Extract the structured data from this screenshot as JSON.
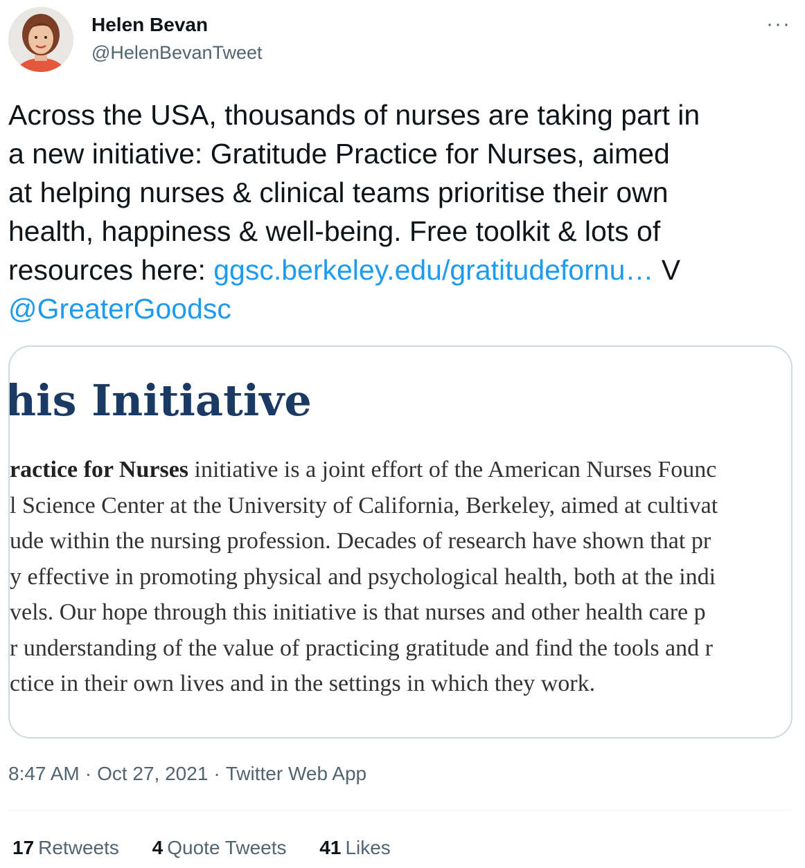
{
  "author": {
    "name": "Helen Bevan",
    "handle": "@HelenBevanTweet",
    "avatar_icon": "profile-photo"
  },
  "menu_icon": "more-dots-icon",
  "tweet": {
    "lines": [
      "Across the USA, thousands of nurses are taking part in",
      "a new initiative: Gratitude Practice for Nurses, aimed",
      "at  helping nurses & clinical teams prioritise their own",
      "health, happiness & well-being. Free toolkit & lots of"
    ],
    "line5_text": "resources here: ",
    "link_text": "ggsc.berkeley.edu/gratitudefornu…",
    "after_link": " V",
    "mention": "@GreaterGoodsc",
    "link_color": "#1d9bf0"
  },
  "card": {
    "title": "'his Initiative",
    "para_bold": "ractice for Nurses",
    "para_first_rest": " initiative is a joint effort of the American Nurses Founc",
    "para_lines": [
      "l Science Center at the University of California, Berkeley, aimed at cultivat",
      "ude within the nursing profession. Decades of research have shown that pr",
      "y effective in promoting physical and psychological health, both at the indi",
      "vels. Our hope through this initiative is that nurses and other health care p",
      "r understanding of the value of practicing gratitude and find the tools and r",
      "ctice in their own lives and in the settings in which they work."
    ],
    "title_color": "#1b3a63"
  },
  "meta": {
    "time": "8:47 AM",
    "date": "Oct 27, 2021",
    "source": "Twitter Web App",
    "separator": "·"
  },
  "stats": {
    "retweets_count": "17",
    "retweets_label": "Retweets",
    "quotes_count": "4",
    "quotes_label": "Quote Tweets",
    "likes_count": "41",
    "likes_label": "Likes"
  }
}
